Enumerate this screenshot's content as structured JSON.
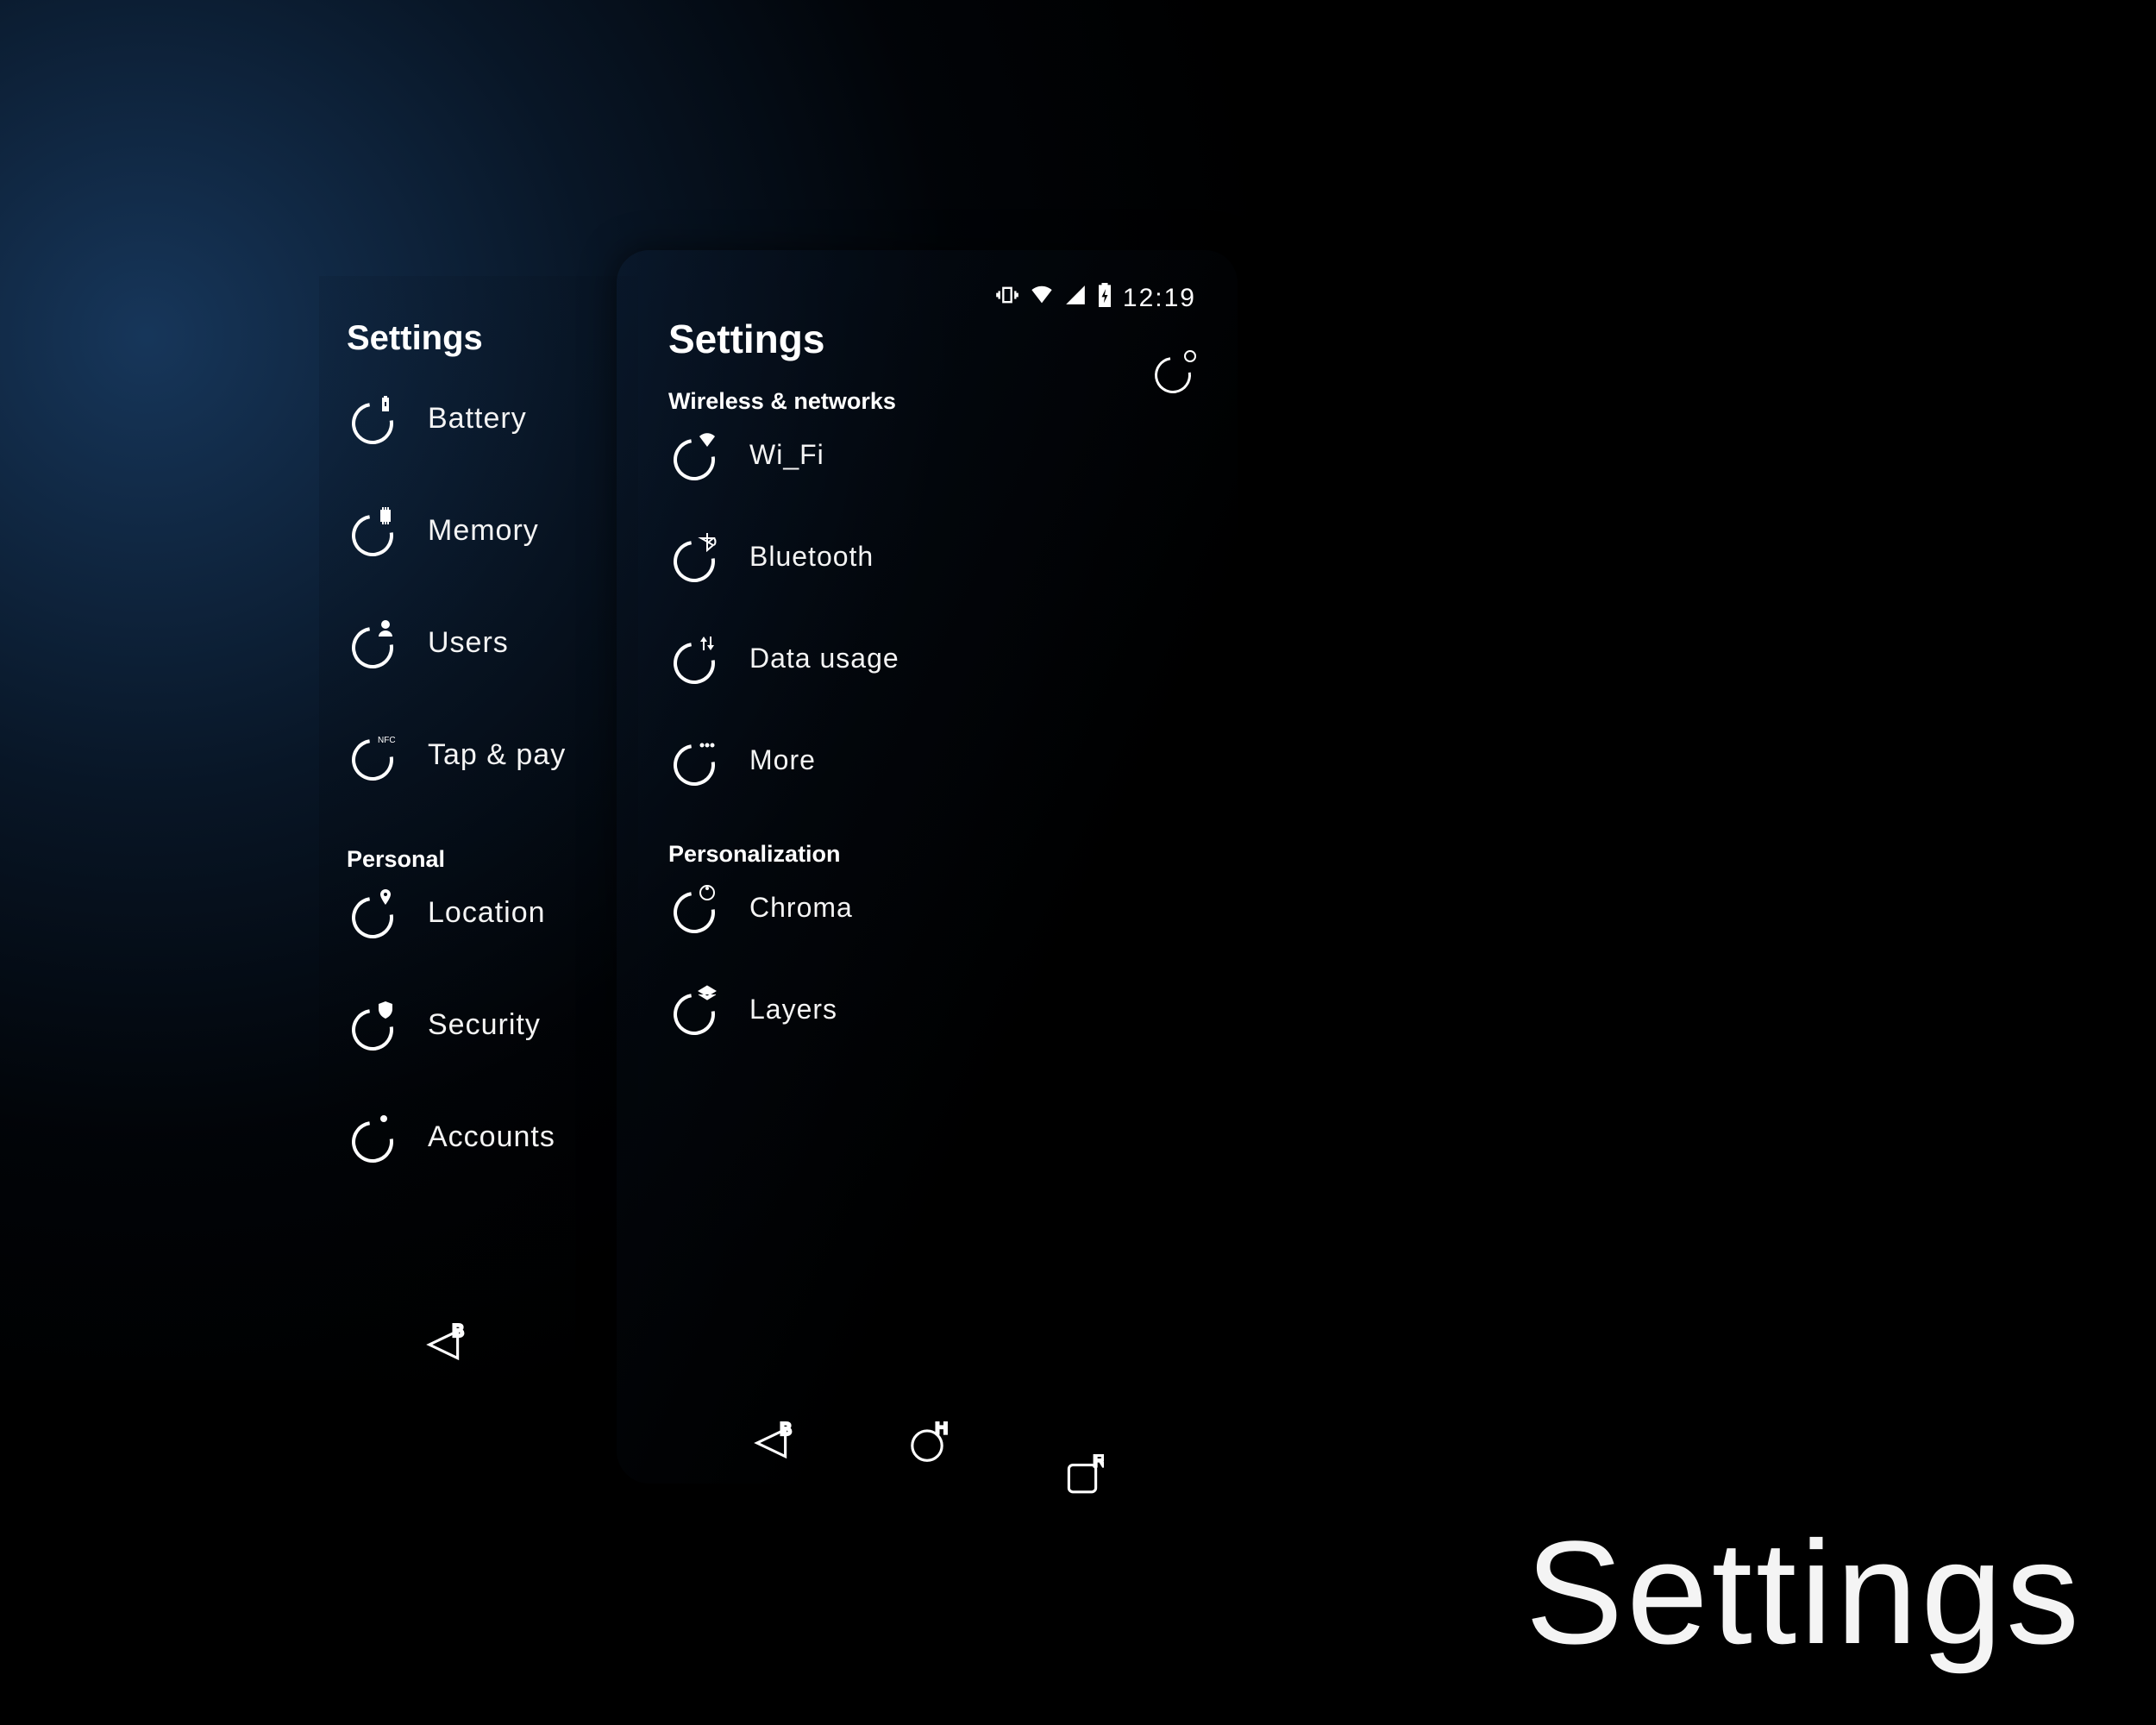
{
  "big_title": "Settings",
  "status_bar": {
    "time": "12:19"
  },
  "back_panel": {
    "title": "Settings",
    "items1": [
      {
        "label": "Battery",
        "icon": "battery-icon"
      },
      {
        "label": "Memory",
        "icon": "memory-icon"
      },
      {
        "label": "Users",
        "icon": "users-icon"
      },
      {
        "label": "Tap & pay",
        "icon": "nfc-icon"
      }
    ],
    "section2": "Personal",
    "items2": [
      {
        "label": "Location",
        "icon": "location-icon"
      },
      {
        "label": "Security",
        "icon": "security-icon"
      },
      {
        "label": "Accounts",
        "icon": "accounts-icon"
      }
    ]
  },
  "front_panel": {
    "title": "Settings",
    "section1": "Wireless & networks",
    "items1": [
      {
        "label": "Wi_Fi",
        "icon": "wifi-icon"
      },
      {
        "label": "Bluetooth",
        "icon": "bluetooth-icon"
      },
      {
        "label": "Data usage",
        "icon": "data-usage-icon"
      },
      {
        "label": "More",
        "icon": "more-icon"
      }
    ],
    "section2": "Personalization",
    "items2": [
      {
        "label": "Chroma",
        "icon": "chroma-icon"
      },
      {
        "label": "Layers",
        "icon": "layers-icon"
      }
    ]
  },
  "nav": {
    "back": "B",
    "home": "H",
    "recents": "R"
  }
}
